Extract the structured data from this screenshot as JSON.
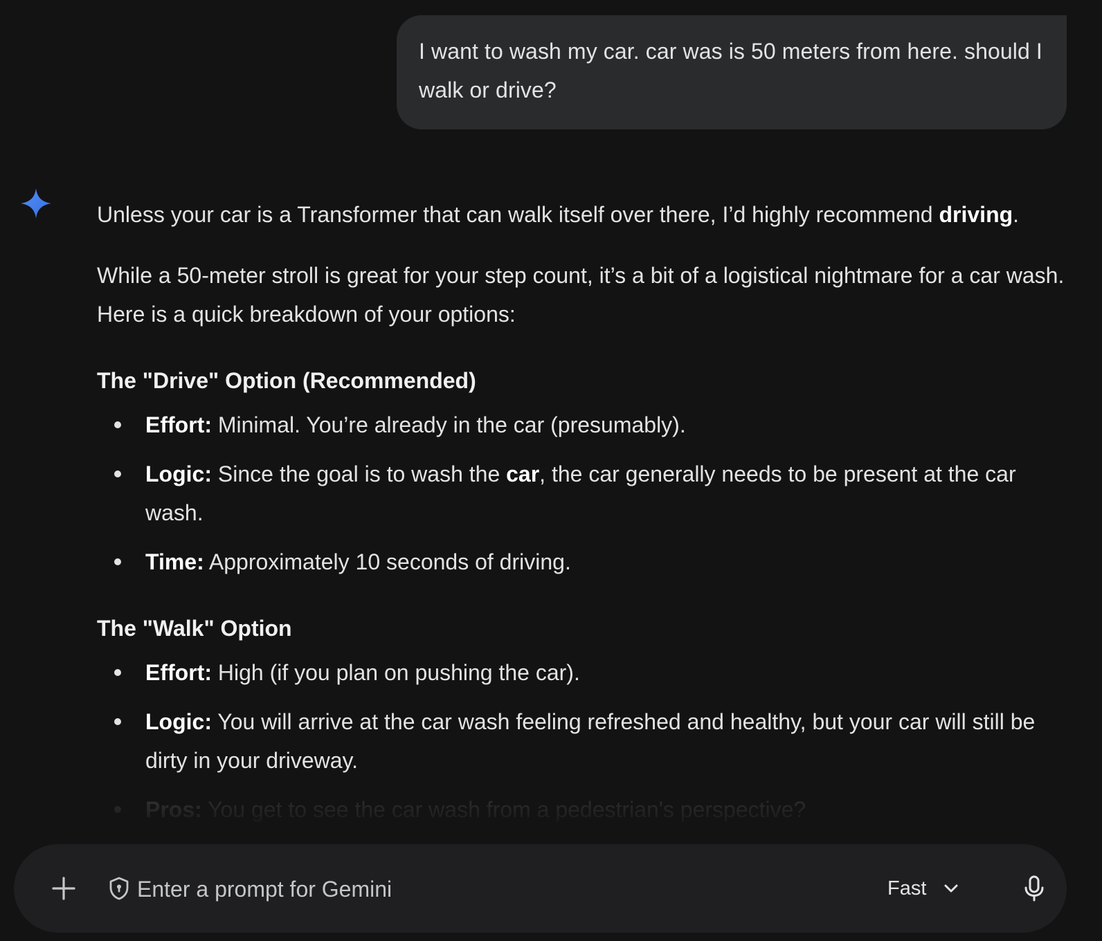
{
  "user_message": {
    "text": "I want to wash my car. car was is 50 meters from here. should I walk or drive?"
  },
  "response": {
    "intro": {
      "before": "Unless your car is a Transformer that can walk itself over there, I’d highly recommend ",
      "bold": "driving",
      "after": "."
    },
    "paragraph2": "While a 50-meter stroll is great for your step count, it’s a bit of a logistical nightmare for a car wash. Here is a quick breakdown of your options:",
    "sections": [
      {
        "heading": "The \"Drive\" Option (Recommended)",
        "items": [
          {
            "label": "Effort:",
            "text": " Minimal. You’re already in the car (presumably)."
          },
          {
            "label": "Logic:",
            "text_before": " Since the goal is to wash the ",
            "bold": "car",
            "text_after": ", the car generally needs to be present at the car wash."
          },
          {
            "label": "Time:",
            "text": " Approximately 10 seconds of driving."
          }
        ]
      },
      {
        "heading": "The \"Walk\" Option",
        "items": [
          {
            "label": "Effort:",
            "text": " High (if you plan on pushing the car)."
          },
          {
            "label": "Logic:",
            "text": " You will arrive at the car wash feeling refreshed and healthy, but your car will still be dirty in your driveway."
          },
          {
            "label": "Pros:",
            "text": " You get to see the car wash from a pedestrian's perspective?"
          }
        ]
      }
    ]
  },
  "input_bar": {
    "placeholder": "Enter a prompt for Gemini",
    "model": "Fast",
    "icons": {
      "add": "plus-icon",
      "privacy": "shield-icon",
      "model_dropdown": "chevron-down-icon",
      "voice": "microphone-icon"
    }
  },
  "colors": {
    "background": "#131314",
    "user_bubble": "#2a2b2d",
    "input_bar": "#1f1f21",
    "text": "#e3e3e3",
    "gemini_star": "#4b8bf5"
  }
}
